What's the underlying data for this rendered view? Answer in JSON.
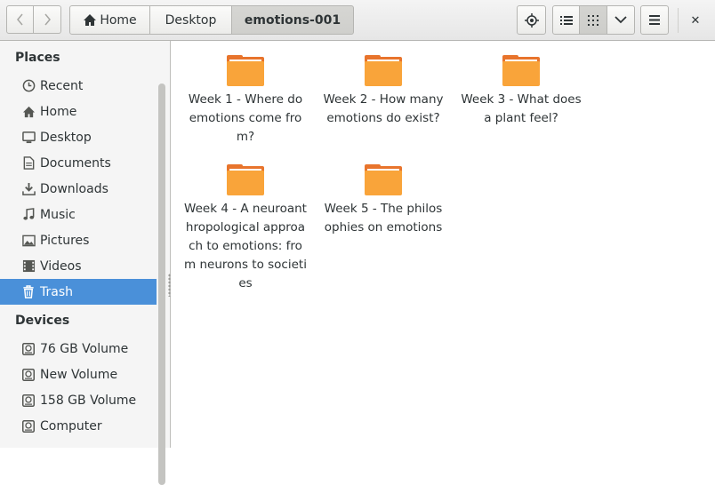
{
  "header": {
    "breadcrumbs": [
      "Home",
      "Desktop",
      "emotions-001"
    ],
    "close_glyph": "✕"
  },
  "sidebar": {
    "sections": [
      {
        "title": "Places",
        "items": [
          {
            "label": "Recent",
            "icon": "clock-icon"
          },
          {
            "label": "Home",
            "icon": "home-icon"
          },
          {
            "label": "Desktop",
            "icon": "desktop-icon"
          },
          {
            "label": "Documents",
            "icon": "document-icon"
          },
          {
            "label": "Downloads",
            "icon": "download-icon"
          },
          {
            "label": "Music",
            "icon": "music-icon"
          },
          {
            "label": "Pictures",
            "icon": "picture-icon"
          },
          {
            "label": "Videos",
            "icon": "film-icon"
          },
          {
            "label": "Trash",
            "icon": "trash-icon",
            "selected": true
          }
        ]
      },
      {
        "title": "Devices",
        "items": [
          {
            "label": "76 GB Volume",
            "icon": "drive-icon"
          },
          {
            "label": "New Volume",
            "icon": "drive-icon"
          },
          {
            "label": "158 GB Volume",
            "icon": "drive-icon"
          },
          {
            "label": "Computer",
            "icon": "drive-icon"
          }
        ]
      }
    ],
    "selected_color": "#4a90d9"
  },
  "folders": [
    {
      "name": "Week 1 - Where do emotions come from?"
    },
    {
      "name": "Week 2 -  How many emotions do exist?"
    },
    {
      "name": "Week 3 - What does a plant feel?"
    },
    {
      "name": "Week 4 - A neuroanthropological approach to emotions: from neurons to societies"
    },
    {
      "name": "Week 5 - The philosophies on emotions"
    }
  ],
  "colors": {
    "folder_front": "#f9a43a",
    "folder_back": "#e8742c"
  }
}
